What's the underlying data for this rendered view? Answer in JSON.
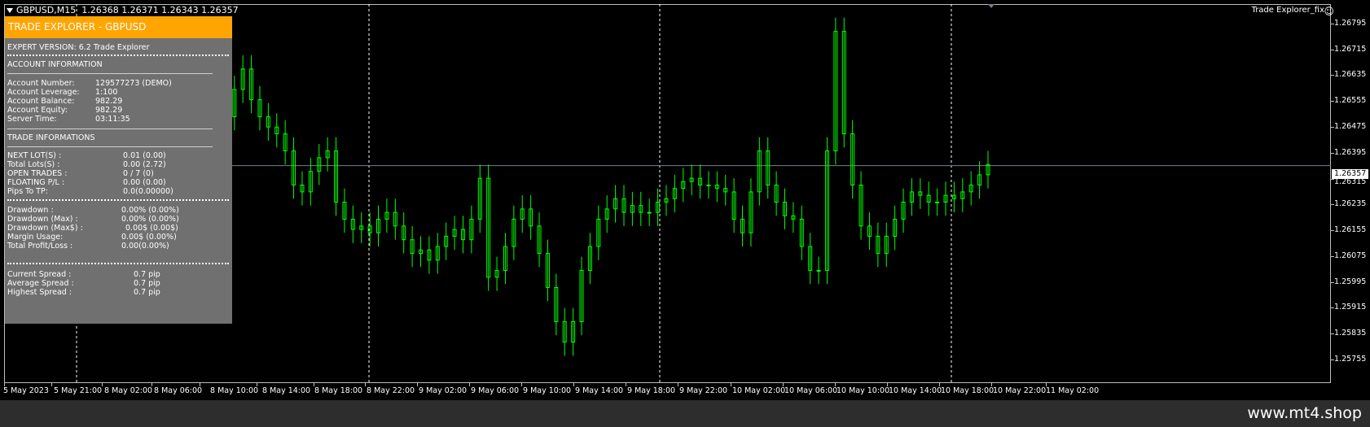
{
  "header": {
    "symbol_tf": "GBPUSD,M15",
    "ohlc": "1.26368 1.26371 1.26343 1.26357",
    "ea_name": "Trade Explorer_fix",
    "ea_icon": "smiley-icon"
  },
  "panel": {
    "title": "TRADE EXPLORER - GBPUSD",
    "expert_version": "EXPERT VERSION: 6.2 Trade Explorer",
    "account_section": "ACCOUNT INFORMATION",
    "account_rows": [
      {
        "label": "Account Number:",
        "value": "129577273 (DEMO)"
      },
      {
        "label": "Account Leverage:",
        "value": "1:100"
      },
      {
        "label": "Account Balance:",
        "value": "982.29"
      },
      {
        "label": "Account Equity:",
        "value": "982.29"
      },
      {
        "label": "Server Time:",
        "value": "03:11:35"
      }
    ],
    "trade_section": "TRADE INFORMATIONS",
    "trade_rows": [
      {
        "label": "NEXT LOT(S) :",
        "value": "0.01 (0.00)"
      },
      {
        "label": "Total Lots(S) :",
        "value": "0.00 (2.72)"
      },
      {
        "label": "OPEN TRADES :",
        "value": "0 / 7 (0)"
      },
      {
        "label": "FLOATING P/L :",
        "value": "0.00 (0.00)"
      },
      {
        "label": "Pips To TP:",
        "value": "0.0(0.00000)"
      }
    ],
    "drawdown_rows": [
      {
        "label": "Drawdown :",
        "value": "0.00% (0.00%)"
      },
      {
        "label": "Drawdown (Max) :",
        "value": "0.00% (0.00%)"
      },
      {
        "label": "Drawdown (Max$) :",
        "value": "0.00$ (0.00$)"
      },
      {
        "label": "Margin Usage:",
        "value": "0.00$ (0.00%)"
      },
      {
        "label": "Total Profit/Loss :",
        "value": "0.00(0.00%)"
      }
    ],
    "spread_rows": [
      {
        "label": "Current Spread :",
        "value": "0.7 pip"
      },
      {
        "label": "Average Spread :",
        "value": "0.7 pip"
      },
      {
        "label": "Highest Spread :",
        "value": "0.7 pip"
      }
    ]
  },
  "price_scale": [
    "1.26795",
    "1.26715",
    "1.26635",
    "1.26555",
    "1.26475",
    "1.26395",
    "1.26315",
    "1.26235",
    "1.26155",
    "1.26075",
    "1.25995",
    "1.25915",
    "1.25835",
    "1.25755"
  ],
  "current_price": "1.26357",
  "time_scale": [
    "5 May 2023",
    "5 May 21:00",
    "8 May 02:00",
    "8 May 06:00",
    "8 May 10:00",
    "8 May 14:00",
    "8 May 18:00",
    "8 May 22:00",
    "9 May 02:00",
    "9 May 06:00",
    "9 May 10:00",
    "9 May 14:00",
    "9 May 18:00",
    "9 May 22:00",
    "10 May 02:00",
    "10 May 06:00",
    "10 May 10:00",
    "10 May 14:00",
    "10 May 18:00",
    "10 May 22:00",
    "11 May 02:00"
  ],
  "footer": {
    "brand": "www.mt4.shop"
  },
  "colors": {
    "candle": "#00ff00",
    "panel_title_bg": "#ffa500",
    "panel_bg": "#707070",
    "price_line": "#708090"
  },
  "chart_data": {
    "type": "line",
    "title": "GBPUSD,M15",
    "xlabel": "",
    "ylabel": "",
    "ylim": [
      1.2572,
      1.2683
    ],
    "current_price": 1.26357,
    "series": [
      {
        "values": [
          1.2638,
          1.265,
          1.2658,
          1.2664,
          1.2655,
          1.265,
          1.2647,
          1.2645,
          1.264,
          1.263,
          1.2628,
          1.2634,
          1.2638,
          1.264,
          1.2625,
          1.262,
          1.2617,
          1.2618,
          1.2616,
          1.262,
          1.2622,
          1.2618,
          1.2614,
          1.261,
          1.2611,
          1.2608,
          1.2612,
          1.2615,
          1.2617,
          1.2614,
          1.262,
          1.2632,
          1.2603,
          1.2605,
          1.2612,
          1.262,
          1.2623,
          1.2618,
          1.261,
          1.26,
          1.259,
          1.2584,
          1.259,
          1.2605,
          1.2612,
          1.262,
          1.2623,
          1.2626,
          1.2622,
          1.2624,
          1.2622,
          1.2622,
          1.2625,
          1.2626,
          1.2629,
          1.2631,
          1.2632,
          1.263,
          1.263,
          1.2629,
          1.2628,
          1.262,
          1.2616,
          1.2628,
          1.264,
          1.263,
          1.2625,
          1.2621,
          1.262,
          1.2612,
          1.2605,
          1.2605,
          1.264,
          1.2675,
          1.2645,
          1.263,
          1.2618,
          1.2615,
          1.261,
          1.2615,
          1.262,
          1.2625,
          1.2628,
          1.2627,
          1.2625,
          1.2625,
          1.2627,
          1.2626,
          1.2628,
          1.263,
          1.2633,
          1.2636
        ]
      }
    ]
  }
}
